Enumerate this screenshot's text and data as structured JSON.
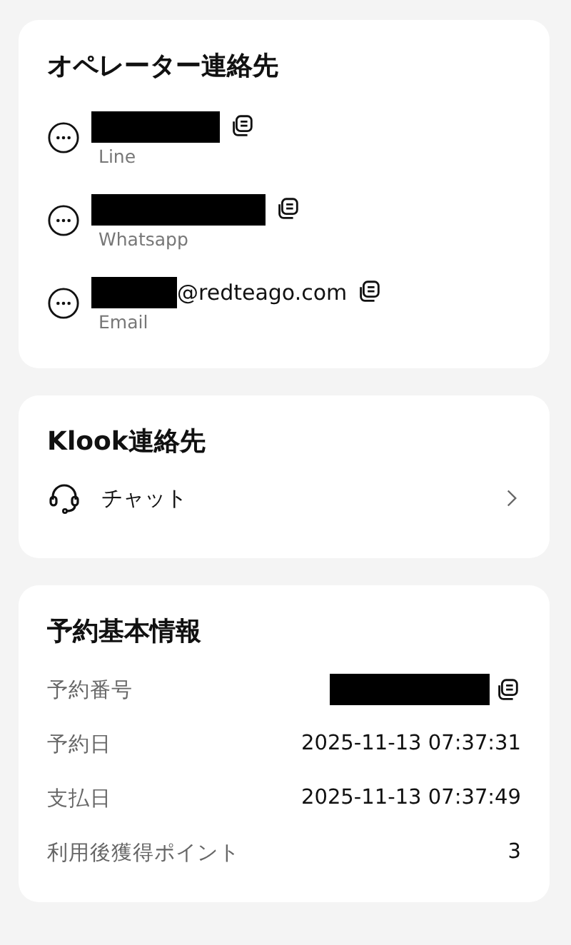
{
  "operator_contacts": {
    "title": "オペレーター連絡先",
    "items": [
      {
        "redacted": true,
        "label": "Line"
      },
      {
        "redacted": true,
        "label": "Whatsapp"
      },
      {
        "redacted": true,
        "suffix": "@redteago.com",
        "label": "Email"
      }
    ]
  },
  "klook_contacts": {
    "title": "Klook連絡先",
    "items": [
      {
        "label": "チャット"
      }
    ]
  },
  "booking_info": {
    "title": "予約基本情報",
    "rows": [
      {
        "kind": "redacted",
        "label": "予約番号"
      },
      {
        "kind": "text",
        "label": "予約日",
        "value": "2025-11-13 07:37:31"
      },
      {
        "kind": "text",
        "label": "支払日",
        "value": "2025-11-13 07:37:49"
      },
      {
        "kind": "text",
        "label": "利用後獲得ポイント",
        "value": "3"
      }
    ]
  }
}
